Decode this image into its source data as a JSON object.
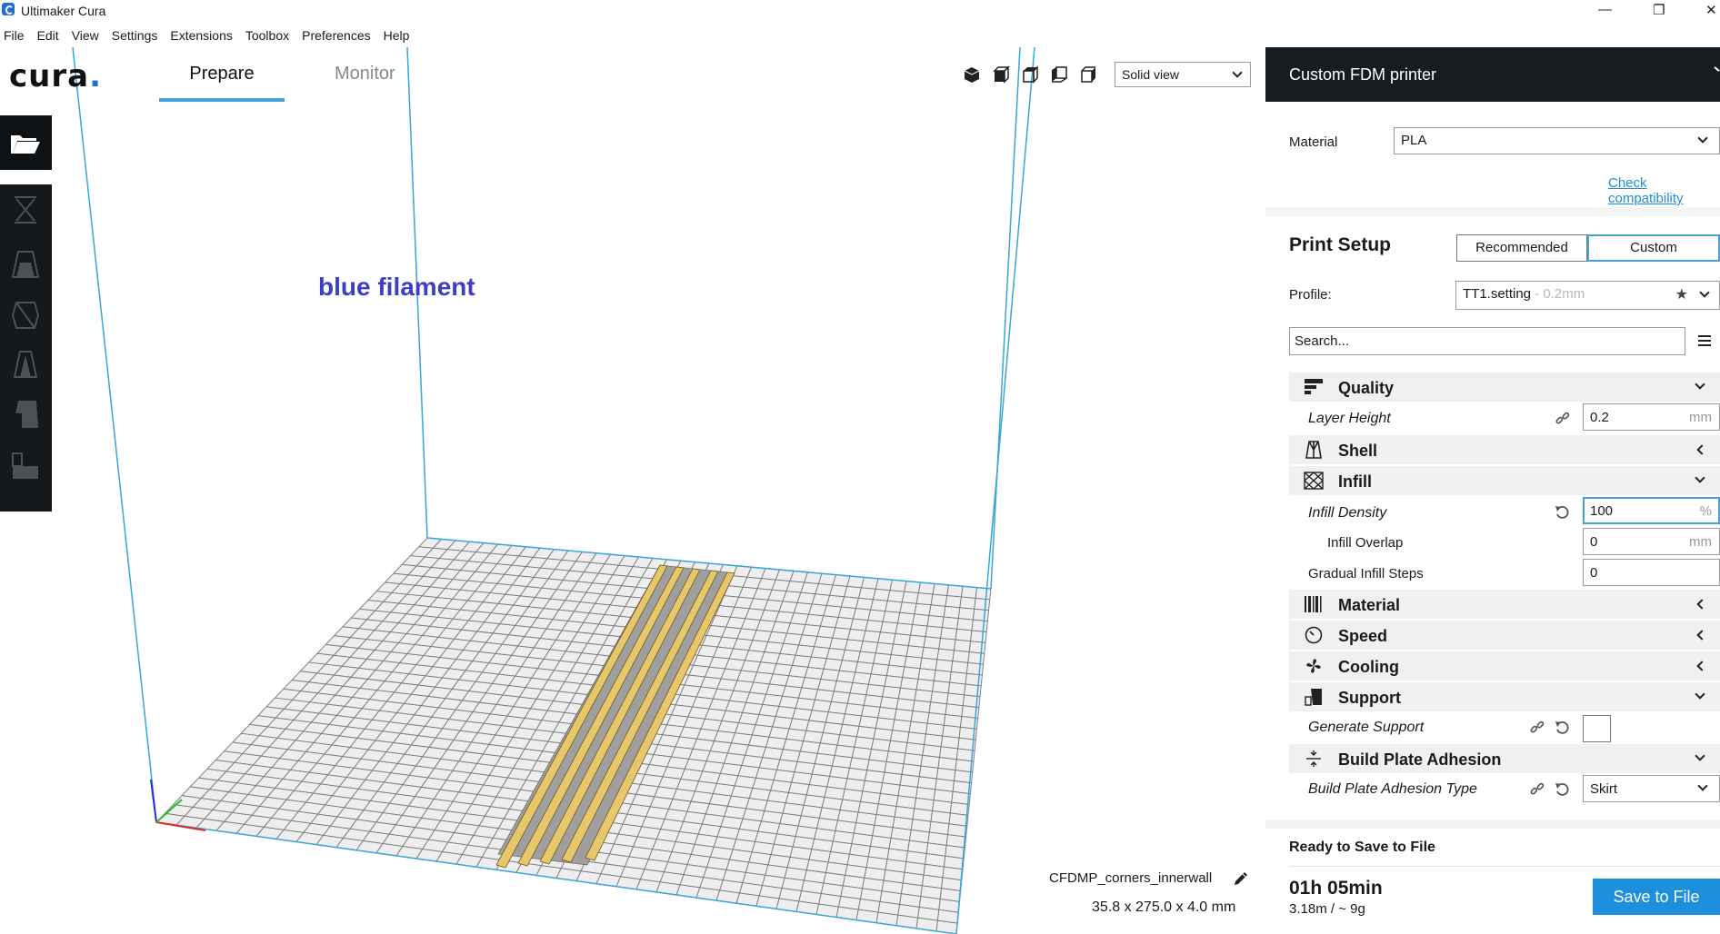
{
  "window": {
    "title": "Ultimaker Cura",
    "minimize": "—",
    "restore": "❐",
    "close": "✕"
  },
  "menu": [
    "File",
    "Edit",
    "View",
    "Settings",
    "Extensions",
    "Toolbox",
    "Preferences",
    "Help"
  ],
  "header": {
    "logo": "cura",
    "logo_dot": ".",
    "tabs": {
      "prepare": "Prepare",
      "monitor": "Monitor"
    },
    "view_mode": "Solid view"
  },
  "viewport": {
    "annotation": "blue filament",
    "model_name": "CFDMP_corners_innerwall",
    "model_dims": "35.8 x 275.0 x 4.0 mm"
  },
  "panel": {
    "printer": "Custom FDM printer",
    "material_label": "Material",
    "material_value": "PLA",
    "check_compat": "Check compatibility",
    "setup_title": "Print Setup",
    "mode_recommended": "Recommended",
    "mode_custom": "Custom",
    "profile_label": "Profile:",
    "profile_value": "TT1.setting",
    "profile_sub": " - 0.2mm",
    "search_placeholder": "Search...",
    "categories": {
      "quality": "Quality",
      "shell": "Shell",
      "infill": "Infill",
      "material": "Material",
      "speed": "Speed",
      "cooling": "Cooling",
      "support": "Support",
      "adhesion": "Build Plate Adhesion"
    },
    "settings": {
      "layer_height": {
        "label": "Layer Height",
        "value": "0.2",
        "unit": "mm"
      },
      "infill_density": {
        "label": "Infill Density",
        "value": "100",
        "unit": "%"
      },
      "infill_overlap": {
        "label": "Infill Overlap",
        "value": "0",
        "unit": "mm"
      },
      "gradual_infill": {
        "label": "Gradual Infill Steps",
        "value": "0"
      },
      "generate_support": {
        "label": "Generate Support"
      },
      "adhesion_type": {
        "label": "Build Plate Adhesion Type",
        "value": "Skirt"
      }
    },
    "save": {
      "ready": "Ready to Save to File",
      "time": "01h 05min",
      "usage": "3.18m / ~ 9g",
      "button": "Save to File"
    }
  },
  "colors": {
    "accent": "#45a2d8",
    "save_button": "#1e8fdc",
    "annotation": "#3d3fbf",
    "model": "#e8c76a",
    "model_shadow": "#9f9f9f"
  }
}
